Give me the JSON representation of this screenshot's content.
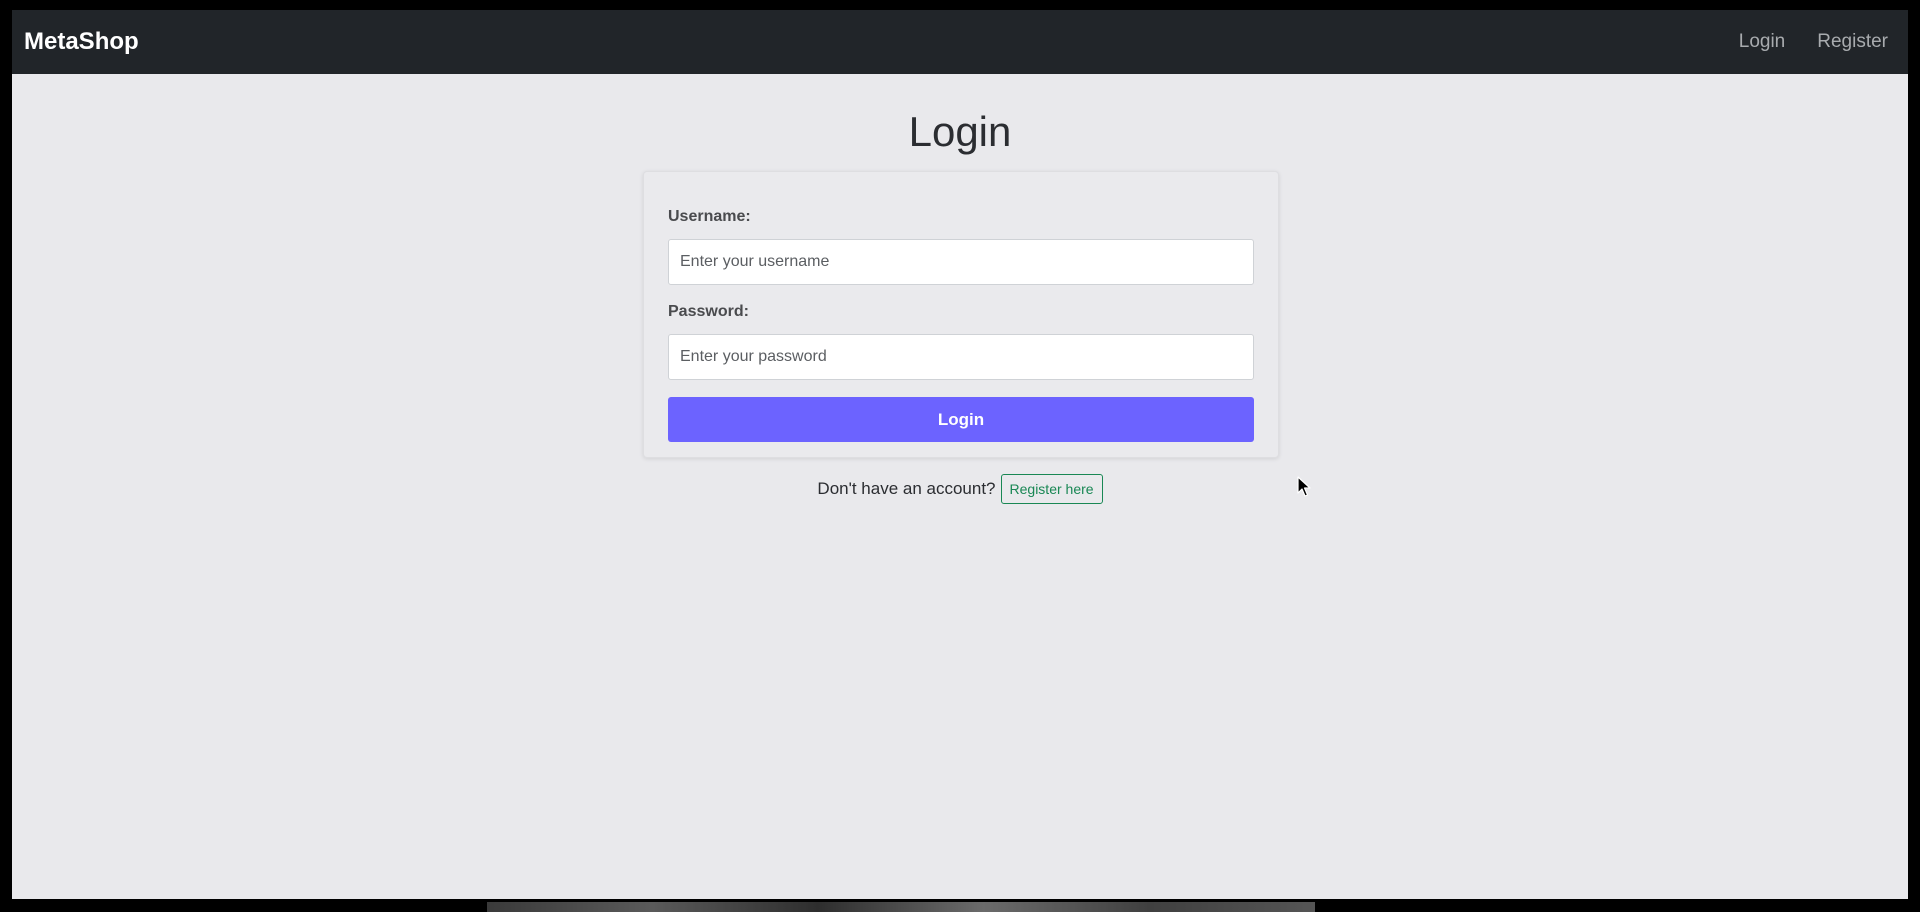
{
  "navbar": {
    "brand": "MetaShop",
    "links": [
      {
        "label": "Login"
      },
      {
        "label": "Register"
      }
    ]
  },
  "main": {
    "title": "Login",
    "form": {
      "username_label": "Username:",
      "username_placeholder": "Enter your username",
      "username_value": "",
      "password_label": "Password:",
      "password_placeholder": "Enter your password",
      "password_value": "",
      "submit_label": "Login"
    },
    "footer": {
      "prompt": "Don't have an account?",
      "register_label": "Register here"
    }
  },
  "colors": {
    "navbar_bg": "#212529",
    "page_bg": "#e9e9ec",
    "accent": "#6c63ff",
    "register_link": "#198754"
  },
  "icons": {
    "cursor": "mouse-pointer-icon"
  }
}
